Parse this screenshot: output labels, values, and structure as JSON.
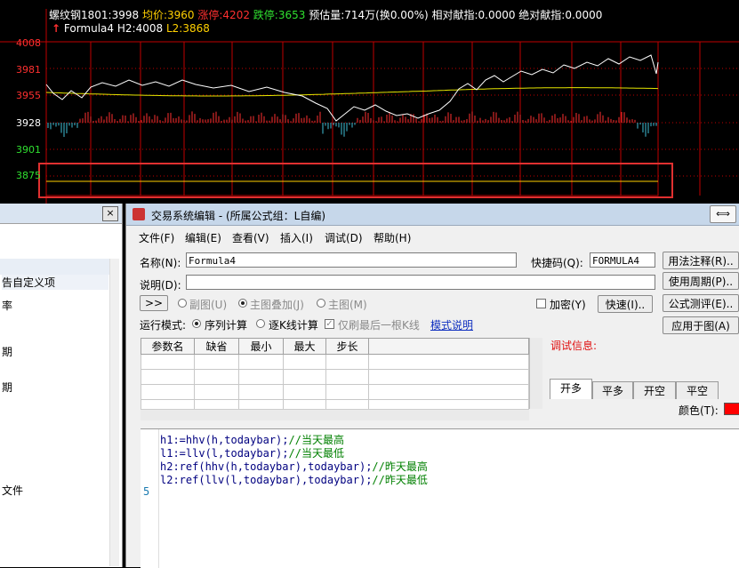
{
  "chart": {
    "header_line1": {
      "symbol": "螺纹钢1801:3998",
      "avg": "均价:3960",
      "up": "涨停:4202",
      "down": "跌停:3653",
      "rest": "预估量:714万(换0.00%) 相对献指:0.0000 绝对献指:0.0000"
    },
    "header_line2": {
      "arrow": "↑",
      "formula": "Formula4",
      "h2": "H2:4008",
      "l2": "L2:3868"
    },
    "y_labels": [
      "4008",
      "3981",
      "3955",
      "3928",
      "3901",
      "3875"
    ],
    "colors": {
      "bg": "#000000",
      "price": "#ffffff",
      "avg": "#e6e600",
      "up_bar": "#ff3030",
      "down_bar": "#40c0d8",
      "grid": "#c00000",
      "highlight": "#e03030"
    }
  },
  "left_panel": {
    "close_glyph": "×",
    "items": [
      "告自定义项",
      "率",
      "期",
      "期",
      "文件"
    ]
  },
  "dialog": {
    "title": "交易系统编辑 - (所属公式组：L自编)",
    "minimize_glyph": "⟺",
    "menu": [
      "文件(F)",
      "编辑(E)",
      "查看(V)",
      "插入(I)",
      "调试(D)",
      "帮助(H)"
    ],
    "name_label": "名称(N):",
    "name_value": "Formula4",
    "shortcut_label": "快捷码(Q):",
    "shortcut_value": "FORMULA4",
    "desc_label": "说明(D):",
    "desc_value": "",
    "right_buttons": [
      "用法注释(R)..",
      "使用周期(P)..",
      "公式测评(E)..",
      "应用于图(A)"
    ],
    "nav_button": ">>",
    "chart_options": [
      "副图(U)",
      "主图叠加(J)",
      "主图(M)"
    ],
    "encrypt_label": "加密(Y)",
    "quick_button": "快速(I)..",
    "run_mode_label": "运行模式:",
    "run_mode_options": [
      "序列计算",
      "逐K线计算"
    ],
    "refresh_only_label": "仅刷最后一根K线",
    "mode_help_link": "模式说明",
    "params_headers": [
      "参数名",
      "缺省",
      "最小",
      "最大",
      "步长"
    ],
    "debug_label": "调试信息:",
    "tabs": [
      "开多",
      "平多",
      "开空",
      "平空"
    ],
    "color_label": "颜色(T):",
    "color_value": "#ff0000",
    "code_lines": [
      {
        "code": "h1:=hhv(h,todaybar);",
        "comment": "//当天最高"
      },
      {
        "code": "l1:=llv(l,todaybar);",
        "comment": "//当天最低"
      },
      {
        "code": "h2:ref(hhv(h,todaybar),todaybar);",
        "comment": "//昨天最高"
      },
      {
        "code": "l2:ref(llv(l,todaybar),todaybar);",
        "comment": "//昨天最低"
      }
    ],
    "line_number": "5"
  }
}
